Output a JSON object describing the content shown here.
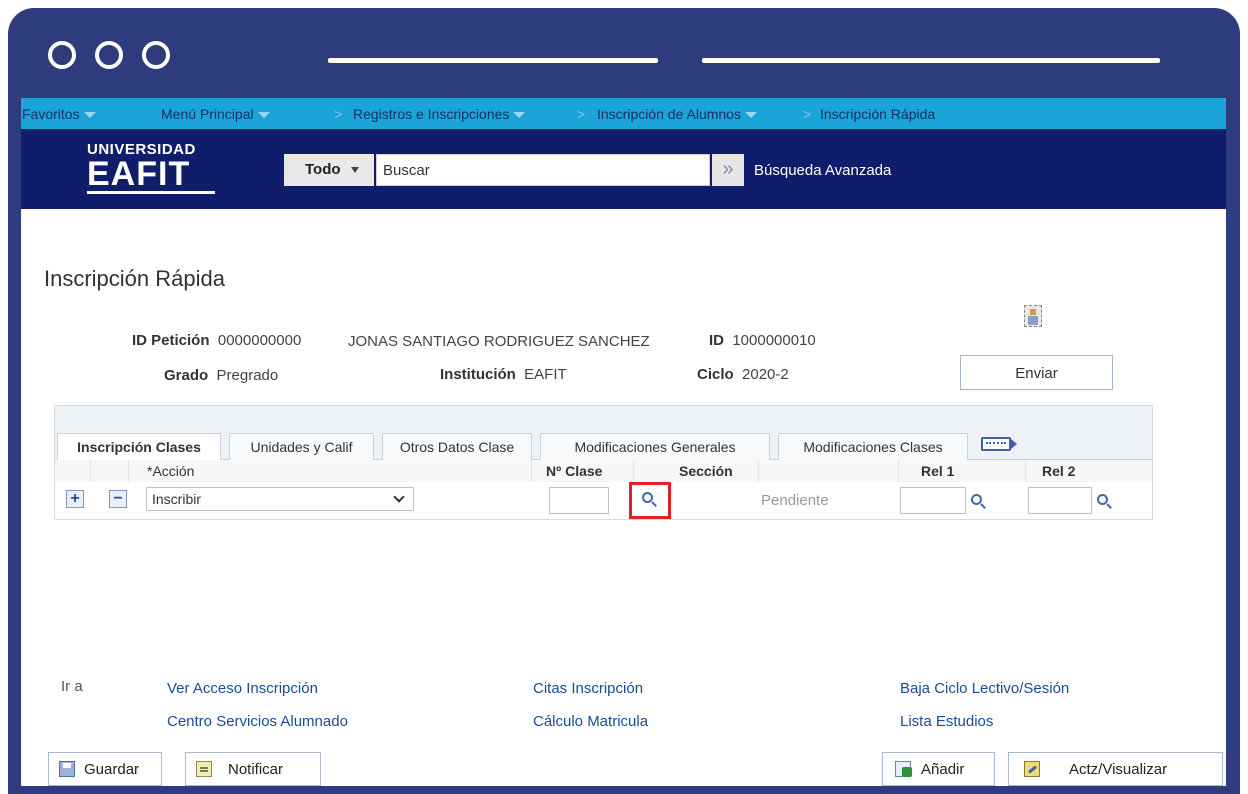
{
  "window": {
    "accent": "#2e3b7c"
  },
  "nav": {
    "favoritos": "Favoritos",
    "menu": "Menú Principal",
    "crumbs": [
      "Registros e Inscripciones",
      "Inscripción de Alumnos",
      "Inscripción Rápida"
    ]
  },
  "header": {
    "logo_top": "UNIVERSIDAD",
    "logo_main": "EAFIT",
    "scope": "Todo",
    "search_value": "Buscar",
    "advanced": "Búsqueda Avanzada"
  },
  "page": {
    "title": "Inscripción Rápida",
    "id_peticion_label": "ID Petición",
    "id_peticion_value": "0000000000",
    "student_name": "JONAS SANTIAGO RODRIGUEZ SANCHEZ",
    "id_label": "ID",
    "id_value": "1000000010",
    "grado_label": "Grado",
    "grado_value": "Pregrado",
    "institucion_label": "Institución",
    "institucion_value": "EAFIT",
    "ciclo_label": "Ciclo",
    "ciclo_value": "2020-2",
    "enviar": "Enviar"
  },
  "tabs": [
    "Inscripción Clases",
    "Unidades y Calif",
    "Otros Datos Clase",
    "Modificaciones Generales",
    "Modificaciones Clases"
  ],
  "columns": {
    "accion": "*Acción",
    "nclase": "Nº Clase",
    "seccion": "Sección",
    "rel1": "Rel 1",
    "rel2": "Rel 2"
  },
  "row": {
    "add": "+",
    "remove": "−",
    "accion_value": "Inscribir",
    "status": "Pendiente"
  },
  "ira": {
    "label": "Ir a",
    "links": [
      "Ver Acceso Inscripción",
      "Citas Inscripción",
      "Baja Ciclo Lectivo/Sesión",
      "Centro Servicios Alumnado",
      "Cálculo Matricula",
      "Lista Estudios"
    ]
  },
  "buttons": {
    "guardar": "Guardar",
    "notificar": "Notificar",
    "anadir": "Añadir",
    "actualizar": "Actz/Visualizar"
  }
}
